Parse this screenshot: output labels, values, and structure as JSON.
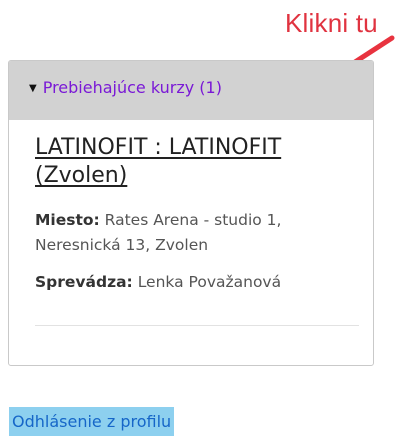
{
  "annotation": {
    "text": "Klikni tu",
    "color": "#e03340"
  },
  "courses_box": {
    "header_toggle": "▼",
    "header_label": "Prebiehajúce kurzy (1)",
    "course": {
      "title": "LATINOFIT : LATINOFIT (Zvolen)",
      "place_label": "Miesto:",
      "place_value": " Rates Arena  - studio 1, Neresnická 13, Zvolen",
      "guide_label": "Sprevádza:",
      "guide_value": " Lenka  Považanová"
    }
  },
  "logout": {
    "label": "Odhlásenie z profilu"
  },
  "colors": {
    "header_bg": "#d2d2d2",
    "link_purple": "#7a19d6",
    "logout_bg": "#8dd0ef",
    "logout_text": "#1666c8"
  },
  "icons": [
    "red-arrow-icon",
    "triangle-down-icon"
  ]
}
